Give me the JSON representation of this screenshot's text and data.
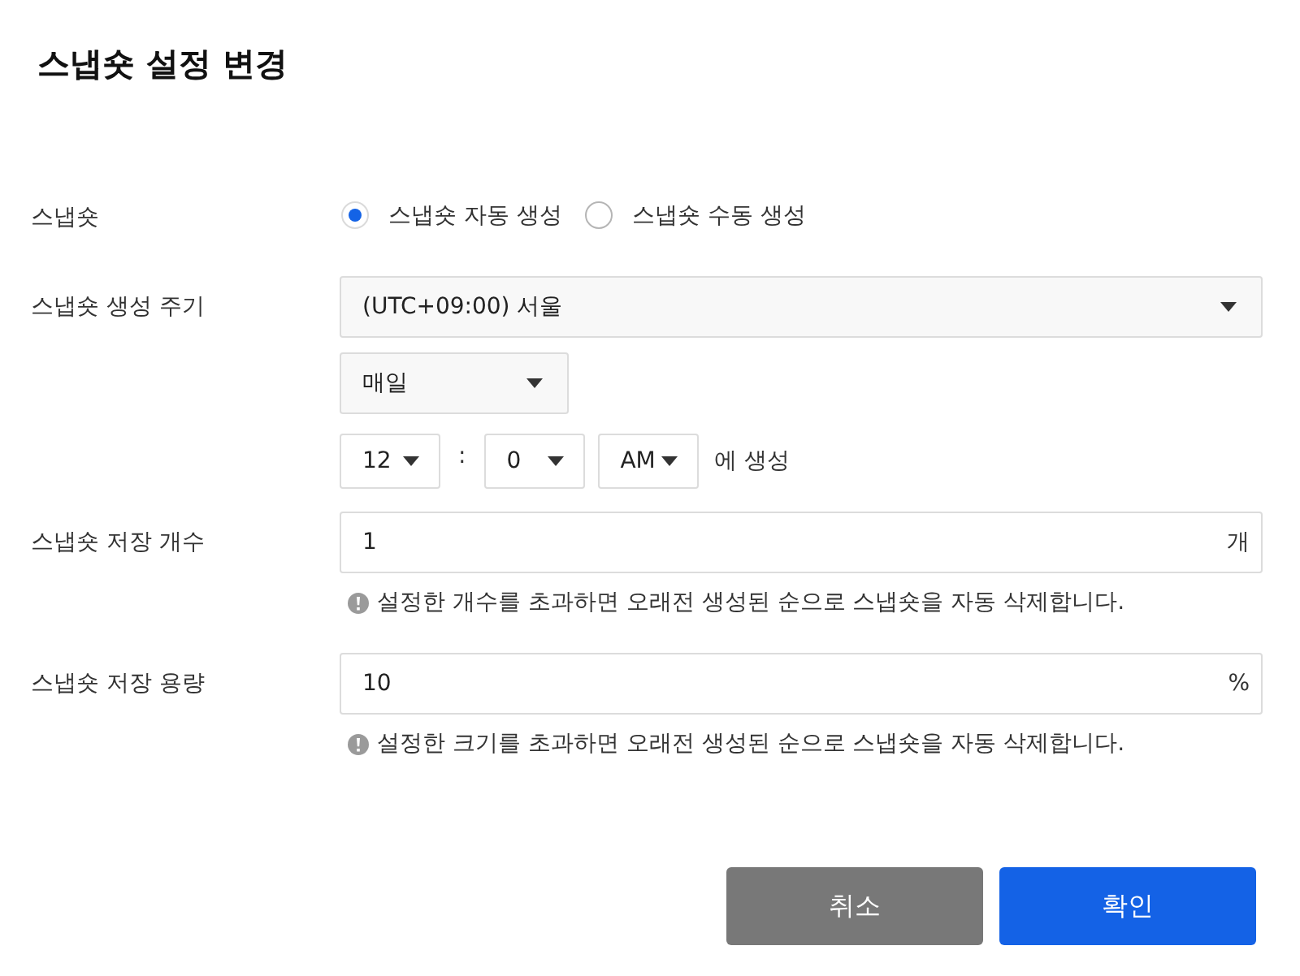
{
  "dialog": {
    "title": "스냅숏 설정 변경"
  },
  "fields": [
    {
      "kind": "radio",
      "label": "스냅숏",
      "options": [
        {
          "label": "스냅숏 자동 생성",
          "selected": true
        },
        {
          "label": "스냅숏 수동 생성",
          "selected": false
        }
      ]
    },
    {
      "kind": "schedule",
      "label": "스냅숏 생성 주기",
      "timezone": "(UTC+09:00) 서울",
      "frequency": "매일",
      "time": [
        {
          "kind": "select",
          "value": "12"
        },
        {
          "kind": "separator",
          "text": ":"
        },
        {
          "kind": "select",
          "value": "0"
        },
        {
          "kind": "select",
          "value": "AM"
        },
        {
          "kind": "text",
          "text": "에 생성"
        }
      ]
    },
    {
      "kind": "number",
      "label": "스냅숏 저장 개수",
      "value": "1",
      "unit": "개",
      "hint": "설정한 개수를 초과하면 오래전 생성된 순으로 스냅숏을 자동 삭제합니다."
    },
    {
      "kind": "number",
      "label": "스냅숏 저장 용량",
      "value": "10",
      "unit": "%",
      "hint": "설정한 크기를 초과하면 오래전 생성된 순으로 스냅숏을 자동 삭제합니다."
    }
  ],
  "buttons": [
    {
      "kind": "secondary",
      "label": "취소"
    },
    {
      "kind": "primary",
      "label": "확인"
    }
  ]
}
